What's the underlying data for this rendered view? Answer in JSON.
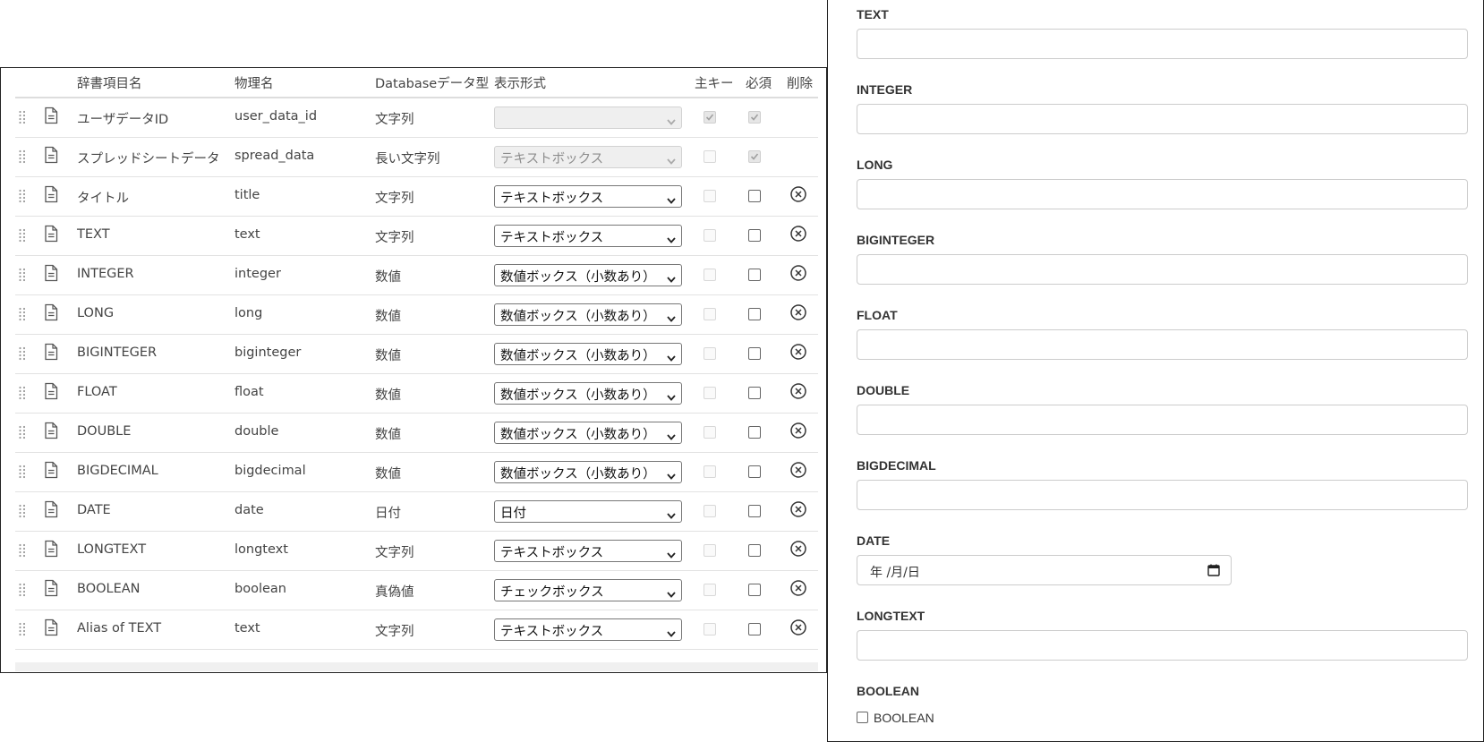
{
  "columns": {
    "item_name": "辞書項目名",
    "physical_name": "物理名",
    "db_type": "Databaseデータ型",
    "display_format": "表示形式",
    "primary_key": "主キー",
    "required": "必須",
    "delete": "削除"
  },
  "rows": [
    {
      "name": "ユーザデータID",
      "physical": "user_data_id",
      "db_type": "文字列",
      "format": "",
      "format_disabled": true,
      "pk_checked": true,
      "pk_disabled": true,
      "required_checked": true,
      "required_disabled": true,
      "deletable": false
    },
    {
      "name": "スプレッドシートデータ",
      "physical": "spread_data",
      "db_type": "長い文字列",
      "format": "テキストボックス",
      "format_disabled": true,
      "pk_checked": false,
      "pk_disabled": true,
      "required_checked": true,
      "required_disabled": true,
      "deletable": false
    },
    {
      "name": "タイトル",
      "physical": "title",
      "db_type": "文字列",
      "format": "テキストボックス",
      "format_disabled": false,
      "pk_checked": false,
      "pk_disabled": true,
      "required_checked": false,
      "required_disabled": false,
      "deletable": true
    },
    {
      "name": "TEXT",
      "physical": "text",
      "db_type": "文字列",
      "format": "テキストボックス",
      "format_disabled": false,
      "pk_checked": false,
      "pk_disabled": true,
      "required_checked": false,
      "required_disabled": false,
      "deletable": true
    },
    {
      "name": "INTEGER",
      "physical": "integer",
      "db_type": "数値",
      "format": "数値ボックス（小数あり）",
      "format_disabled": false,
      "pk_checked": false,
      "pk_disabled": true,
      "required_checked": false,
      "required_disabled": false,
      "deletable": true
    },
    {
      "name": "LONG",
      "physical": "long",
      "db_type": "数値",
      "format": "数値ボックス（小数あり）",
      "format_disabled": false,
      "pk_checked": false,
      "pk_disabled": true,
      "required_checked": false,
      "required_disabled": false,
      "deletable": true
    },
    {
      "name": "BIGINTEGER",
      "physical": "biginteger",
      "db_type": "数値",
      "format": "数値ボックス（小数あり）",
      "format_disabled": false,
      "pk_checked": false,
      "pk_disabled": true,
      "required_checked": false,
      "required_disabled": false,
      "deletable": true
    },
    {
      "name": "FLOAT",
      "physical": "float",
      "db_type": "数値",
      "format": "数値ボックス（小数あり）",
      "format_disabled": false,
      "pk_checked": false,
      "pk_disabled": true,
      "required_checked": false,
      "required_disabled": false,
      "deletable": true
    },
    {
      "name": "DOUBLE",
      "physical": "double",
      "db_type": "数値",
      "format": "数値ボックス（小数あり）",
      "format_disabled": false,
      "pk_checked": false,
      "pk_disabled": true,
      "required_checked": false,
      "required_disabled": false,
      "deletable": true
    },
    {
      "name": "BIGDECIMAL",
      "physical": "bigdecimal",
      "db_type": "数値",
      "format": "数値ボックス（小数あり）",
      "format_disabled": false,
      "pk_checked": false,
      "pk_disabled": true,
      "required_checked": false,
      "required_disabled": false,
      "deletable": true
    },
    {
      "name": "DATE",
      "physical": "date",
      "db_type": "日付",
      "format": "日付",
      "format_disabled": false,
      "pk_checked": false,
      "pk_disabled": true,
      "required_checked": false,
      "required_disabled": false,
      "deletable": true
    },
    {
      "name": "LONGTEXT",
      "physical": "longtext",
      "db_type": "文字列",
      "format": "テキストボックス",
      "format_disabled": false,
      "pk_checked": false,
      "pk_disabled": true,
      "required_checked": false,
      "required_disabled": false,
      "deletable": true
    },
    {
      "name": "BOOLEAN",
      "physical": "boolean",
      "db_type": "真偽値",
      "format": "チェックボックス",
      "format_disabled": false,
      "pk_checked": false,
      "pk_disabled": true,
      "required_checked": false,
      "required_disabled": false,
      "deletable": true
    },
    {
      "name": "Alias of TEXT",
      "physical": "text",
      "db_type": "文字列",
      "format": "テキストボックス",
      "format_disabled": false,
      "pk_checked": false,
      "pk_disabled": true,
      "required_checked": false,
      "required_disabled": false,
      "deletable": true
    }
  ],
  "form": {
    "fields": [
      {
        "label": "TEXT",
        "type": "text",
        "value": ""
      },
      {
        "label": "INTEGER",
        "type": "text",
        "value": ""
      },
      {
        "label": "LONG",
        "type": "text",
        "value": ""
      },
      {
        "label": "BIGINTEGER",
        "type": "text",
        "value": ""
      },
      {
        "label": "FLOAT",
        "type": "text",
        "value": ""
      },
      {
        "label": "DOUBLE",
        "type": "text",
        "value": ""
      },
      {
        "label": "BIGDECIMAL",
        "type": "text",
        "value": ""
      },
      {
        "label": "DATE",
        "type": "date",
        "value": "年 /月/日"
      },
      {
        "label": "LONGTEXT",
        "type": "text",
        "value": ""
      },
      {
        "label": "BOOLEAN",
        "type": "checkbox",
        "checkbox_label": "BOOLEAN",
        "checked": false
      }
    ]
  },
  "icons": {
    "drag": "drag-handle-icon",
    "document": "document-icon",
    "delete": "circle-x-icon",
    "select_arrow": "chevron-down-icon",
    "calendar": "calendar-icon",
    "check": "checkmark-icon"
  },
  "colors": {
    "border": "#cccccc",
    "row_divider": "#e2e2e2",
    "disabled_bg": "#efefef",
    "text": "#333333"
  }
}
